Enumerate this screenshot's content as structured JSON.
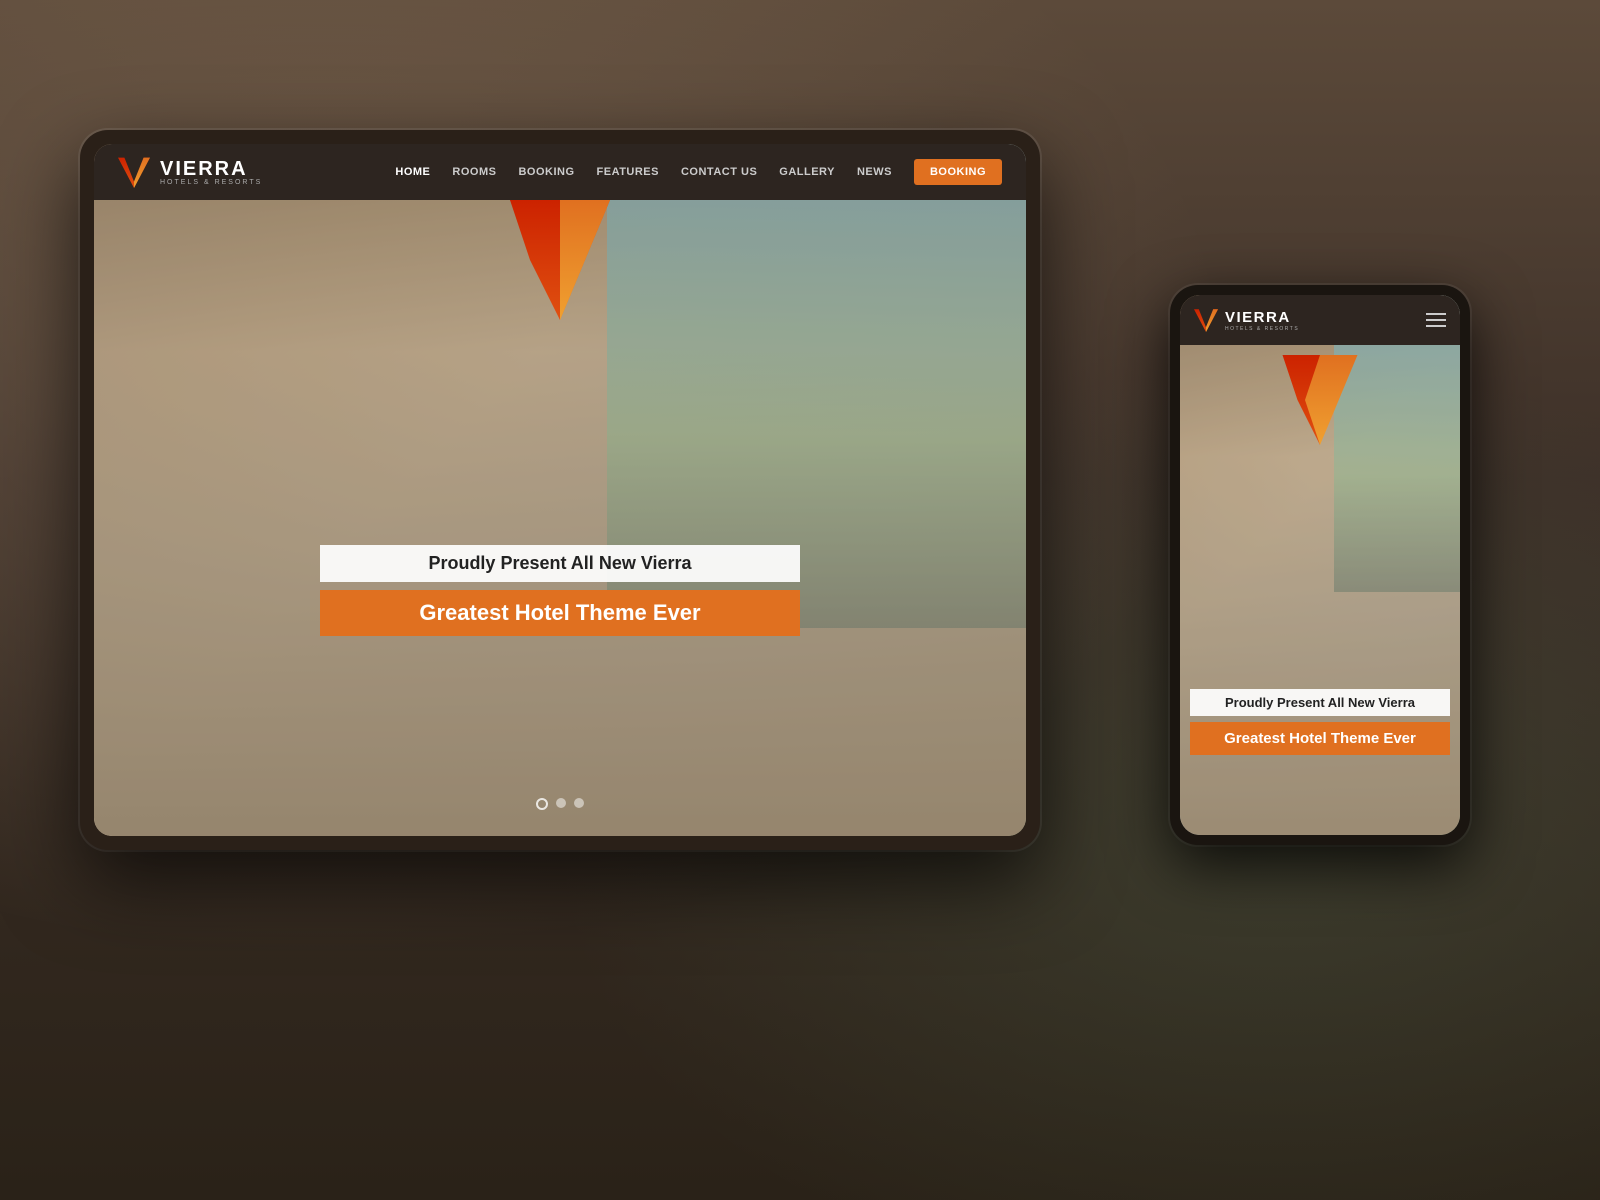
{
  "background": {
    "overlay_opacity": "0.55"
  },
  "tablet": {
    "navbar": {
      "logo_name": "VIERRA",
      "logo_subtitle": "HOTELS & RESORTS",
      "nav_items": [
        "HOME",
        "ROOMS",
        "BOOKING",
        "FEATURES",
        "CONTACT US",
        "GALLERY",
        "NEWS"
      ],
      "booking_button": "BOOKING"
    },
    "hero": {
      "tagline": "Proudly Present All New Vierra",
      "headline": "Greatest Hotel Theme Ever",
      "slide_dots": 3,
      "active_dot": 0
    }
  },
  "mobile": {
    "navbar": {
      "logo_name": "VIERRA",
      "logo_subtitle": "HOTELS & RESORTS"
    },
    "hero": {
      "tagline": "Proudly Present All New Vierra",
      "headline": "Greatest Hotel Theme Ever"
    }
  },
  "colors": {
    "accent_orange": "#e07020",
    "dark_nav": "#2d2520",
    "white": "#ffffff"
  }
}
